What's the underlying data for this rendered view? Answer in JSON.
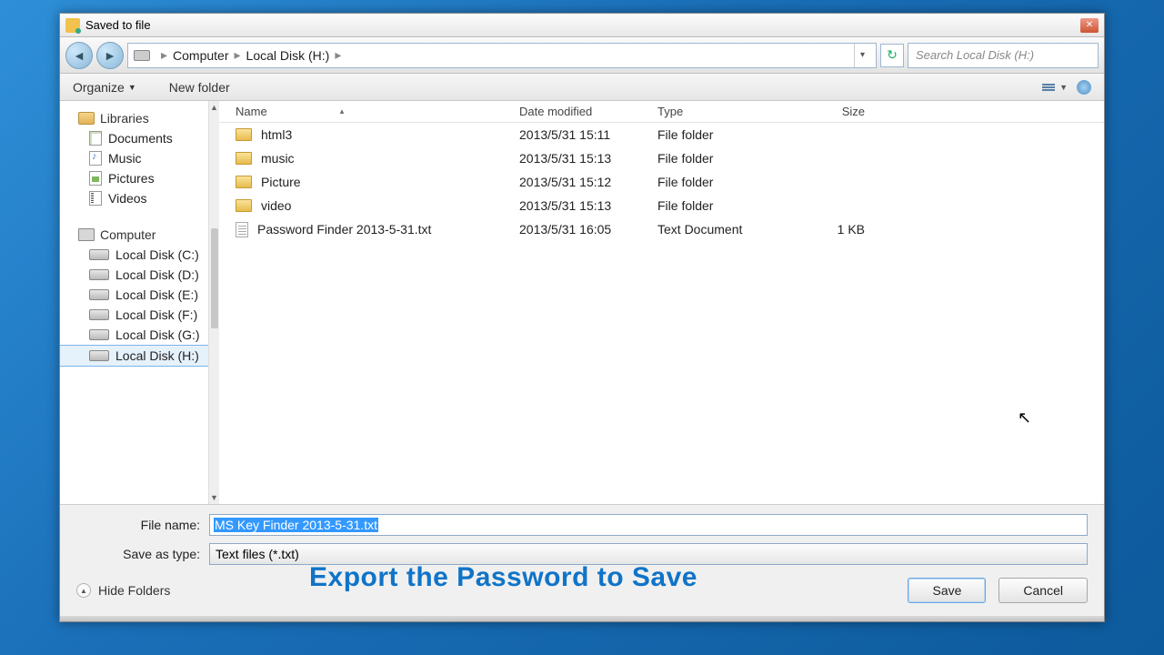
{
  "window": {
    "title": "Saved to file"
  },
  "nav": {
    "crumbs": [
      "Computer",
      "Local Disk (H:)"
    ],
    "search_placeholder": "Search Local Disk (H:)"
  },
  "toolbar": {
    "organize": "Organize",
    "new_folder": "New folder"
  },
  "sidebar": {
    "libraries_label": "Libraries",
    "libraries": [
      {
        "label": "Documents"
      },
      {
        "label": "Music"
      },
      {
        "label": "Pictures"
      },
      {
        "label": "Videos"
      }
    ],
    "computer_label": "Computer",
    "drives": [
      {
        "label": "Local Disk (C:)"
      },
      {
        "label": "Local Disk (D:)"
      },
      {
        "label": "Local Disk (E:)"
      },
      {
        "label": "Local Disk (F:)"
      },
      {
        "label": "Local Disk (G:)"
      },
      {
        "label": "Local Disk (H:)"
      }
    ]
  },
  "columns": {
    "name": "Name",
    "date": "Date modified",
    "type": "Type",
    "size": "Size"
  },
  "rows": [
    {
      "name": "html3",
      "date": "2013/5/31 15:11",
      "type": "File folder",
      "size": "",
      "kind": "folder"
    },
    {
      "name": "music",
      "date": "2013/5/31 15:13",
      "type": "File folder",
      "size": "",
      "kind": "folder"
    },
    {
      "name": "Picture",
      "date": "2013/5/31 15:12",
      "type": "File folder",
      "size": "",
      "kind": "folder"
    },
    {
      "name": "video",
      "date": "2013/5/31 15:13",
      "type": "File folder",
      "size": "",
      "kind": "folder"
    },
    {
      "name": "Password Finder 2013-5-31.txt",
      "date": "2013/5/31 16:05",
      "type": "Text Document",
      "size": "1 KB",
      "kind": "txt"
    }
  ],
  "form": {
    "filename_label": "File name:",
    "filename_value": "MS Key Finder 2013-5-31.txt",
    "save_type_label": "Save as type:",
    "save_type_value": "Text files (*.txt)"
  },
  "footer": {
    "hide_folders": "Hide Folders",
    "save": "Save",
    "cancel": "Cancel"
  },
  "overlay": "Export the  Password to Save"
}
